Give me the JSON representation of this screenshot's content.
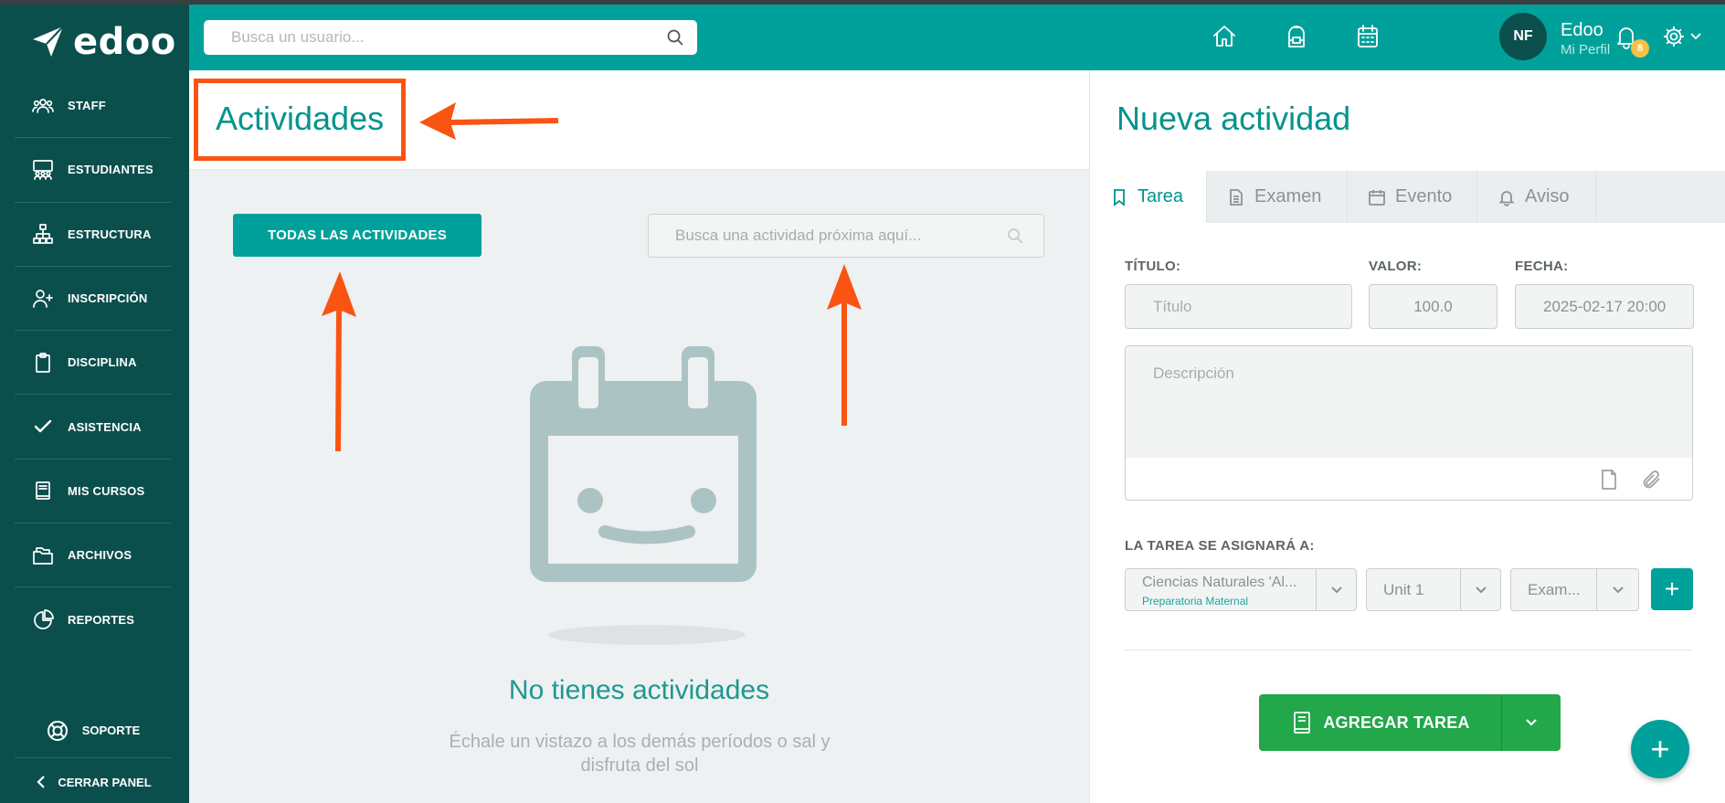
{
  "brand": {
    "name": "edoo",
    "logo_icon": "paper-plane-icon"
  },
  "sidebar": {
    "items": [
      {
        "label": "STAFF",
        "icon": "users-icon"
      },
      {
        "label": "ESTUDIANTES",
        "icon": "students-icon"
      },
      {
        "label": "ESTRUCTURA",
        "icon": "hierarchy-icon"
      },
      {
        "label": "INSCRIPCIÓN",
        "icon": "user-plus-icon"
      },
      {
        "label": "DISCIPLINA",
        "icon": "clipboard-icon"
      },
      {
        "label": "ASISTENCIA",
        "icon": "check-icon"
      },
      {
        "label": "MIS CURSOS",
        "icon": "book-icon"
      },
      {
        "label": "ARCHIVOS",
        "icon": "folders-icon"
      },
      {
        "label": "REPORTES",
        "icon": "pie-chart-icon"
      }
    ],
    "support_label": "SOPORTE",
    "collapse_label": "CERRAR PANEL"
  },
  "header": {
    "search_placeholder": "Busca un usuario...",
    "notification_count": "8",
    "avatar_initials": "NF",
    "user_name": "Edoo",
    "user_link": "Mi Perfil",
    "icons": [
      "home-icon",
      "backpack-icon",
      "calendar-icon",
      "bell-icon",
      "gear-icon"
    ]
  },
  "main": {
    "title": "Actividades",
    "all_button": "TODAS LAS ACTIVIDADES",
    "search_placeholder": "Busca una actividad próxima aquí...",
    "empty_title": "No tienes actividades",
    "empty_subtitle": "Échale un vistazo a los demás períodos o sal y disfruta del sol"
  },
  "panel": {
    "title": "Nueva actividad",
    "tabs": [
      {
        "label": "Tarea",
        "icon": "bookmark-icon",
        "active": true
      },
      {
        "label": "Examen",
        "icon": "document-icon",
        "active": false
      },
      {
        "label": "Evento",
        "icon": "calendar-icon",
        "active": false
      },
      {
        "label": "Aviso",
        "icon": "bell-icon",
        "active": false
      }
    ],
    "form": {
      "title_label": "TÍTULO:",
      "title_placeholder": "Título",
      "value_label": "VALOR:",
      "value": "100.0",
      "date_label": "FECHA:",
      "date_value": "2025-02-17 20:00",
      "description_placeholder": "Descripción",
      "assign_label": "LA TAREA SE ASIGNARÁ A:",
      "course_select": "Ciencias Naturales 'Al...",
      "course_sub": "Preparatoria Maternal",
      "unit_select": "Unit 1",
      "type_select": "Exam...",
      "add_button": "AGREGAR TAREA"
    }
  },
  "colors": {
    "sidebar": "#0b4f4d",
    "accent": "#00a19a",
    "highlight": "#fa5412",
    "success": "#22a74a"
  }
}
